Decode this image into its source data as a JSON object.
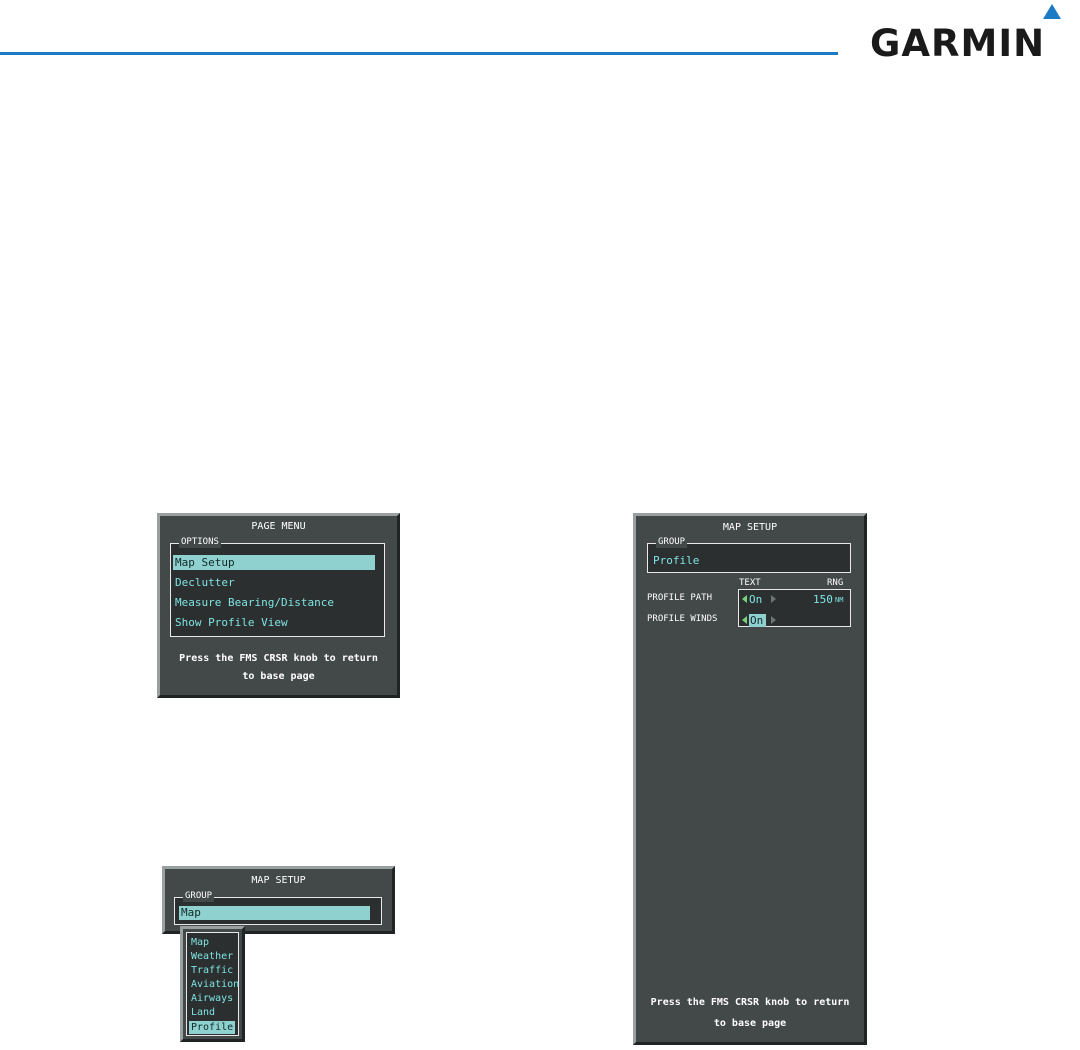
{
  "header": {
    "brand": "GARMIN"
  },
  "page_menu": {
    "title": "PAGE MENU",
    "options_label": "OPTIONS",
    "items": [
      {
        "label": "Map Setup",
        "selected": true
      },
      {
        "label": "Declutter",
        "selected": false
      },
      {
        "label": "Measure Bearing/Distance",
        "selected": false
      },
      {
        "label": "Show Profile View",
        "selected": false
      }
    ],
    "footer_line1": "Press the FMS CRSR knob to return",
    "footer_line2": "to base page"
  },
  "map_setup_small": {
    "title": "MAP SETUP",
    "group_label": "GROUP",
    "group_value": "Map",
    "dropdown_options": [
      {
        "label": "Map",
        "selected": false
      },
      {
        "label": "Weather",
        "selected": false
      },
      {
        "label": "Traffic",
        "selected": false
      },
      {
        "label": "Aviation",
        "selected": false
      },
      {
        "label": "Airways",
        "selected": false
      },
      {
        "label": "Land",
        "selected": false
      },
      {
        "label": "Profile",
        "selected": true
      }
    ]
  },
  "map_setup_profile": {
    "title": "MAP SETUP",
    "group_label": "GROUP",
    "group_value": "Profile",
    "col_text": "TEXT",
    "col_rng": "RNG",
    "rows": [
      {
        "label": "PROFILE PATH",
        "text": "On",
        "range": "150",
        "range_unit": "NM"
      },
      {
        "label": "PROFILE WINDS",
        "text": "On"
      }
    ],
    "footer_line1": "Press the FMS CRSR knob to return",
    "footer_line2": "to base page"
  },
  "colors": {
    "accent_blue": "#1a7bc4",
    "window_bg": "#434848",
    "cyan_text": "#7fe3e3",
    "selection_bg": "#8fd1cf"
  }
}
